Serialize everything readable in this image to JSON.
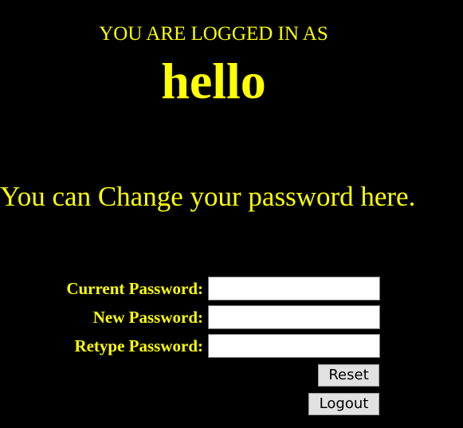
{
  "header": {
    "logged_in_label": "YOU ARE LOGGED IN AS",
    "username": "hello"
  },
  "main": {
    "heading": "You can Change your password here."
  },
  "form": {
    "current_password_label": "Current Password:",
    "current_password_value": "",
    "new_password_label": "New Password:",
    "new_password_value": "",
    "retype_password_label": "Retype Password:",
    "retype_password_value": "",
    "reset_label": "Reset",
    "logout_label": "Logout"
  },
  "colors": {
    "background": "#000000",
    "text": "#ffff00",
    "input_background": "#ffffff",
    "button_background": "#e1e1e1"
  }
}
